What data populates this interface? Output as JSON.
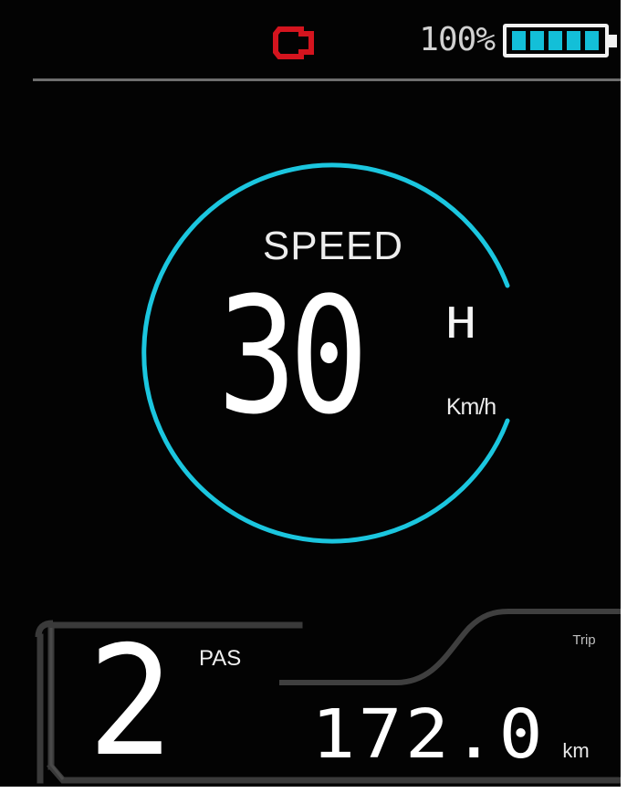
{
  "status_bar": {
    "motor_icon": "motor-warning-icon",
    "battery_percent": "100%",
    "battery_icon": "battery-icon",
    "battery_level": 1.0
  },
  "speed": {
    "label": "SPEED",
    "value": "30",
    "mode": "H",
    "unit": "Km/h"
  },
  "assist": {
    "value": "2",
    "label": "PAS"
  },
  "trip": {
    "label": "Trip",
    "value": "172.0",
    "unit": "km"
  },
  "colors": {
    "background": "#030303",
    "accent": "#1bc6df",
    "warning": "#d4141e",
    "text": "#ffffff",
    "muted": "#6e6e6e"
  }
}
